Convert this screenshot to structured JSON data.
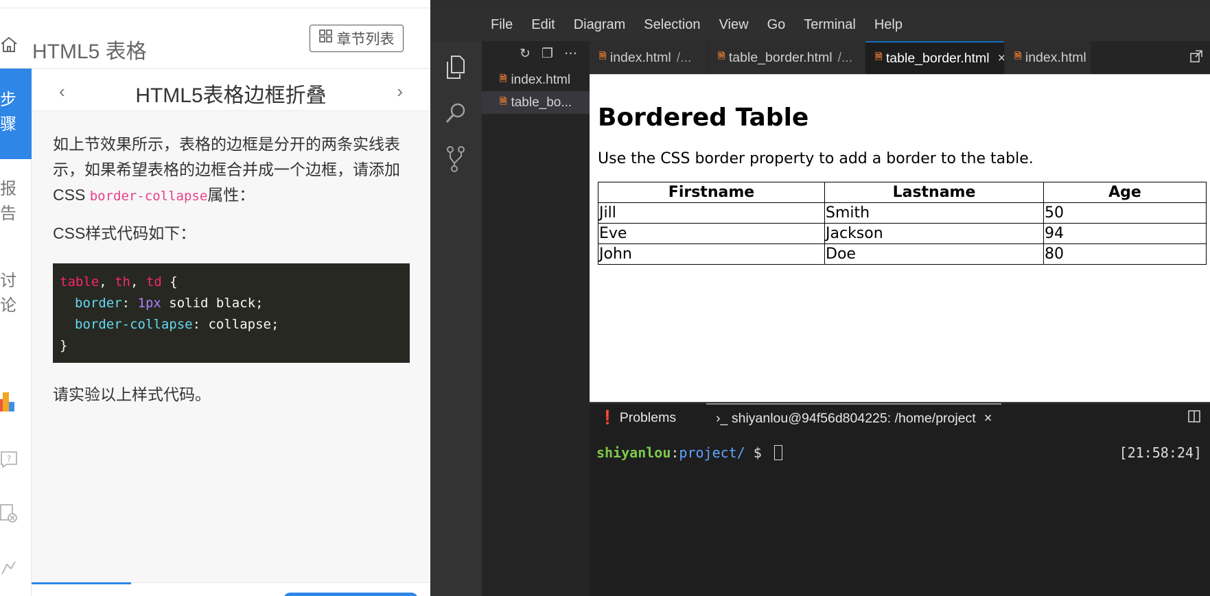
{
  "tutorial": {
    "course_title": "HTML5 表格",
    "chapters_button": "章节列表",
    "rail": {
      "steps": [
        "步",
        "骤"
      ],
      "report": [
        "报",
        "告"
      ],
      "discuss": [
        "讨",
        "论"
      ]
    },
    "step_title": "HTML5表格边框折叠",
    "paragraph1_before": "如上节效果所示，表格的边框是分开的两条实线表示，如果希望表格的边框合并成一个边框，请添加CSS ",
    "paragraph1_code": "border-collapse",
    "paragraph1_after": "属性：",
    "paragraph2": "CSS样式代码如下：",
    "code": {
      "selector_table": "table",
      "comma1": ", ",
      "selector_th": "th",
      "comma2": ", ",
      "selector_td": "td",
      "open_brace": " {",
      "prop1": "border",
      "colon1": ": ",
      "num1": "1px",
      "val1": " solid black;",
      "prop2": "border-collapse",
      "colon2": ": ",
      "val2": "collapse;",
      "close_brace": "}"
    },
    "paragraph3": "请实验以上样式代码。"
  },
  "ide": {
    "menu": [
      "File",
      "Edit",
      "Diagram",
      "Selection",
      "View",
      "Go",
      "Terminal",
      "Help"
    ],
    "explorer_files": [
      {
        "name": "index.html",
        "active": false
      },
      {
        "name": "table_bo...",
        "active": true
      }
    ],
    "tabs": [
      {
        "name": "index.html",
        "path": "/..."
      },
      {
        "name": "table_border.html",
        "path": "/..."
      },
      {
        "name": "table_border.html",
        "path": "",
        "active": true,
        "close": "×"
      },
      {
        "name": "index.html",
        "path": ""
      }
    ],
    "preview": {
      "heading": "Bordered Table",
      "description": "Use the CSS border property to add a border to the table.",
      "table": {
        "headers": [
          "Firstname",
          "Lastname",
          "Age"
        ],
        "rows": [
          [
            "Jill",
            "Smith",
            "50"
          ],
          [
            "Eve",
            "Jackson",
            "94"
          ],
          [
            "John",
            "Doe",
            "80"
          ]
        ]
      }
    },
    "panel": {
      "tab_problems": "Problems",
      "tab_terminal": "shiyanlou@94f56d804225: /home/project",
      "tab_close": "×"
    },
    "terminal": {
      "user": "shiyanlou",
      "sep": ":",
      "path": "project/",
      "prompt": " $ ",
      "time": "[21:58:24]"
    }
  }
}
